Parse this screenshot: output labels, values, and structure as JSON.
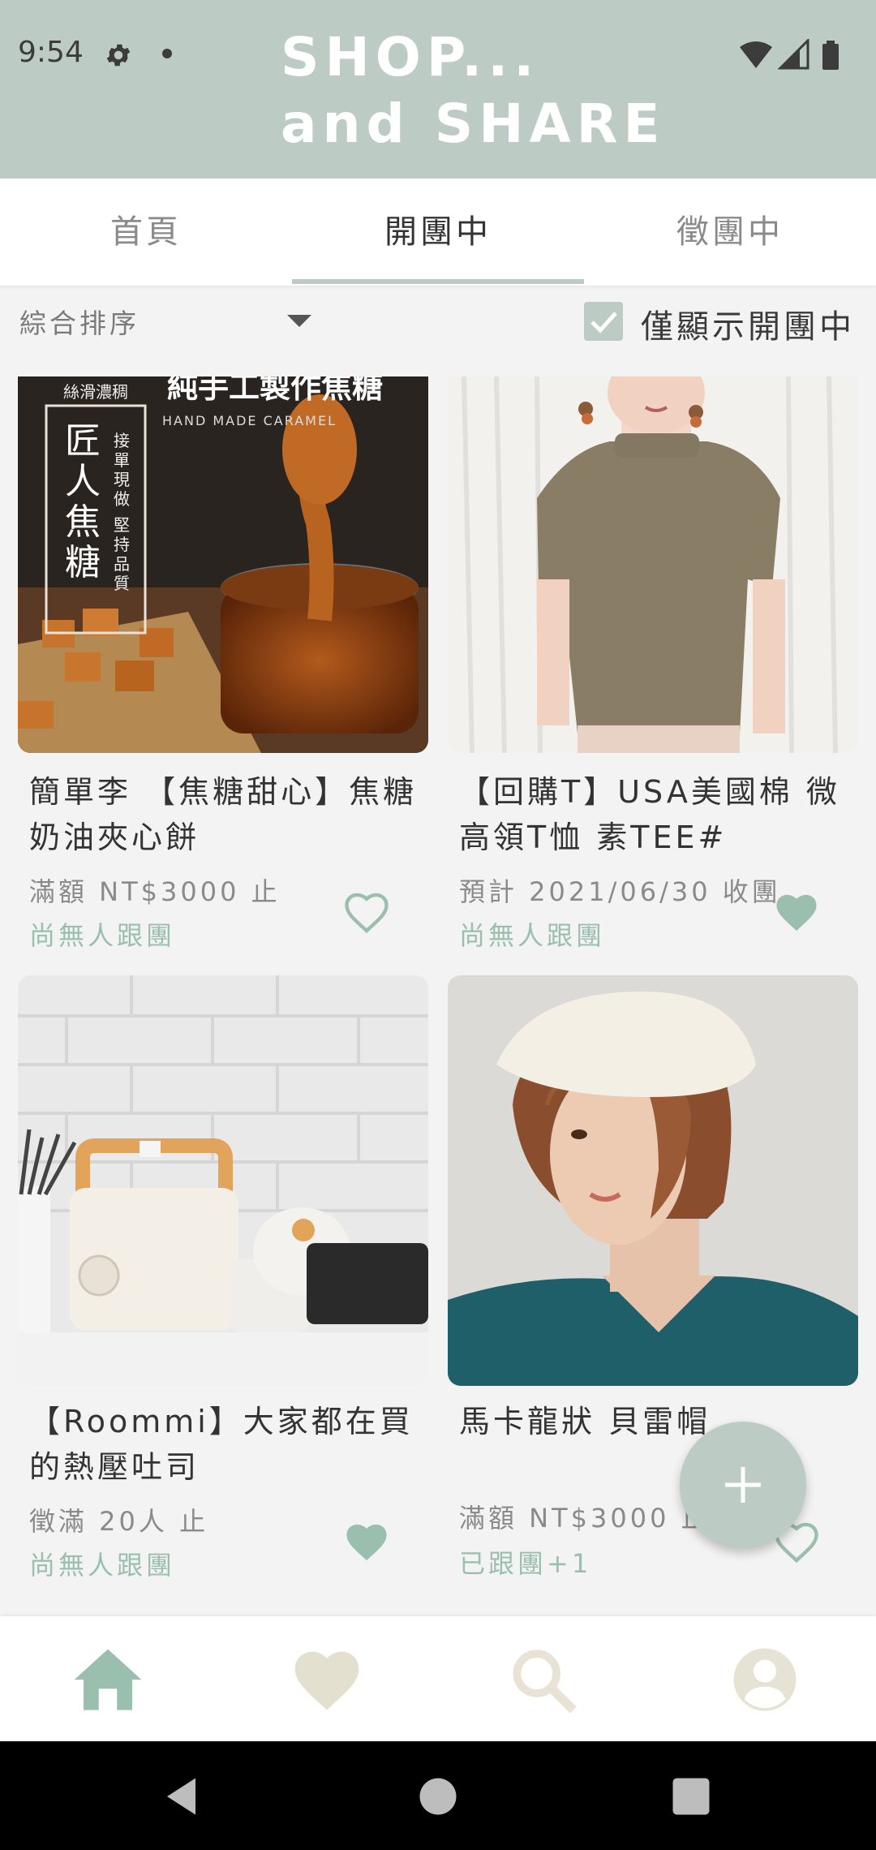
{
  "status_bar": {
    "time": "9:54"
  },
  "app": {
    "title_line1": "SHOP...",
    "title_line2": "and SHARE"
  },
  "tabs": [
    {
      "label": "首頁"
    },
    {
      "label": "開團中"
    },
    {
      "label": "徵團中"
    }
  ],
  "filter": {
    "sort_label": "綜合排序",
    "only_open_label": "僅顯示開團中",
    "only_open_checked": true
  },
  "cards": [
    {
      "img_line1": "純手工製作焦糖",
      "img_line2": "HAND MADE CARAMEL",
      "img_tag": "絲滑濃稠",
      "img_big": "匠人焦糖",
      "img_side": "接單現做 堅持品質",
      "title": "簡單李 【焦糖甜心】焦糖奶油夾心餅",
      "condition": "滿額 NT$3000 止",
      "status": "尚無人跟團",
      "favorited": false
    },
    {
      "title": "【回購T】USA美國棉 微高領T恤 素TEE#",
      "condition": "預計 2021/06/30 收團",
      "status": "尚無人跟團",
      "favorited": true
    },
    {
      "title": "【Roommi】大家都在買的熱壓吐司",
      "condition": "徵滿 20人 止",
      "status": "尚無人跟團",
      "favorited": true
    },
    {
      "title": "馬卡龍狀 貝雷帽",
      "condition": "滿額 NT$3000 止",
      "status": "已跟團+1",
      "favorited": false
    }
  ],
  "fab": {
    "icon": "plus-icon"
  },
  "bottom_nav": [
    {
      "icon": "home-icon"
    },
    {
      "icon": "heart-icon"
    },
    {
      "icon": "search-icon"
    },
    {
      "icon": "account-icon"
    }
  ],
  "colors": {
    "accent": "#bccbc3",
    "status_text": "#9bbfae",
    "heart": "#9bbfae"
  }
}
